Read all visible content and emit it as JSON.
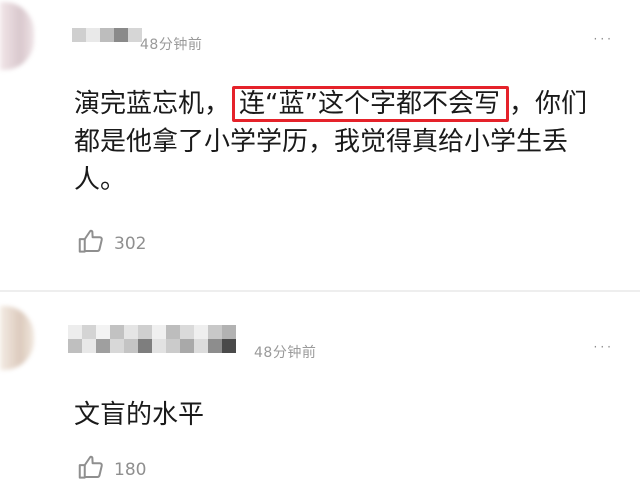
{
  "comments": [
    {
      "time": "48分钟前",
      "more_label": "···",
      "text_prefix": "演完蓝忘机，",
      "text_highlight": "连“蓝”这个字都不会写",
      "text_suffix": "，你们都是他拿了小学学历，我觉得真给小学生丢人。",
      "likes": "302"
    },
    {
      "time": "48分钟前",
      "more_label": "···",
      "text": "文盲的水平",
      "likes": "180"
    }
  ],
  "colors": {
    "highlight_border": "#e5222a",
    "meta_text": "#9a9a9a"
  },
  "icons": {
    "like": "thumbs-up-icon",
    "more": "more-dots-icon"
  }
}
